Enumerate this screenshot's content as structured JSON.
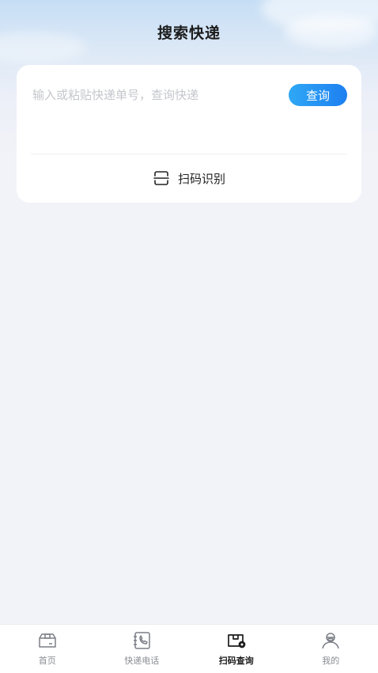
{
  "header": {
    "title": "搜索快递"
  },
  "search": {
    "placeholder": "输入或粘贴快递单号，查询快递",
    "value": "",
    "button_label": "查询"
  },
  "scan": {
    "label": "扫码识别",
    "icon": "scan-icon"
  },
  "tabbar": {
    "items": [
      {
        "label": "首页",
        "icon": "package-icon",
        "active": false
      },
      {
        "label": "快递电话",
        "icon": "phone-book-icon",
        "active": false
      },
      {
        "label": "扫码查询",
        "icon": "scan-package-icon",
        "active": true
      },
      {
        "label": "我的",
        "icon": "user-icon",
        "active": false
      }
    ]
  },
  "colors": {
    "accent": "#1d7ff0",
    "background": "#f2f3f8",
    "card": "#ffffff",
    "inactive_tab": "#8a8d94"
  }
}
